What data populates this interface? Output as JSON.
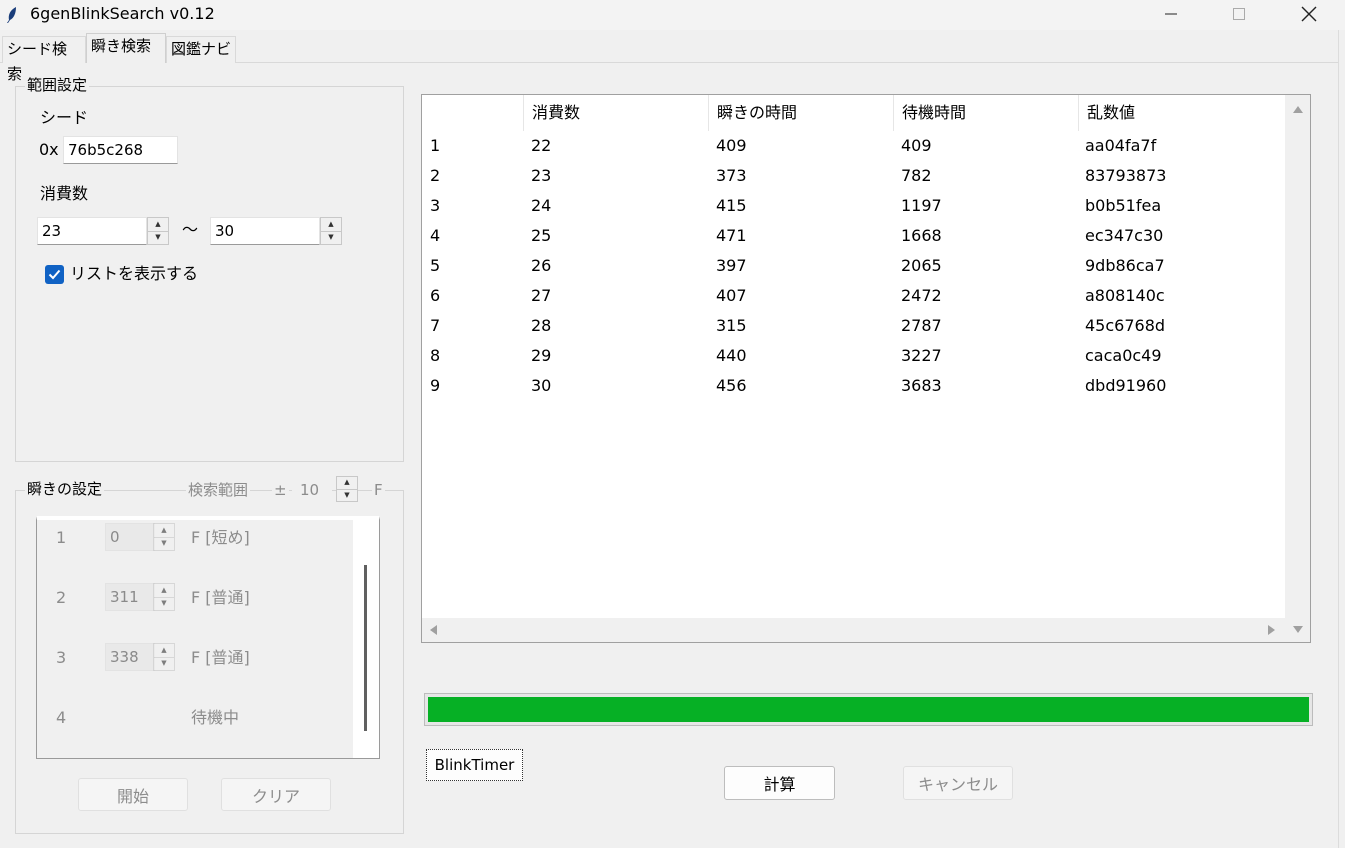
{
  "window": {
    "title": "6genBlinkSearch v0.12"
  },
  "tabs": [
    {
      "label": "シード検索"
    },
    {
      "label": "瞬き検索"
    },
    {
      "label": "図鑑ナビ"
    }
  ],
  "range_settings": {
    "group_title": "範囲設定",
    "seed_label": "シード",
    "seed_prefix": "0x",
    "seed_value": "76b5c268",
    "consumption_label": "消費数",
    "consumption_min": "23",
    "range_separator": "～",
    "consumption_max": "30",
    "show_list_label": "リストを表示する",
    "show_list_checked": true
  },
  "blink_settings": {
    "group_title": "瞬きの設定",
    "search_range_label": "検索範囲",
    "plus_minus": "±",
    "search_range_value": "10",
    "search_range_unit": "F",
    "rows": [
      {
        "index": "1",
        "value": "0",
        "type": "F [短め]"
      },
      {
        "index": "2",
        "value": "311",
        "type": "F [普通]"
      },
      {
        "index": "3",
        "value": "338",
        "type": "F [普通]"
      },
      {
        "index": "4",
        "value": "",
        "type": "待機中"
      }
    ],
    "start_button": "開始",
    "clear_button": "クリア"
  },
  "results": {
    "columns": [
      "",
      "消費数",
      "瞬きの時間",
      "待機時間",
      "乱数値"
    ],
    "rows": [
      [
        "1",
        "22",
        "409",
        "409",
        "aa04fa7f"
      ],
      [
        "2",
        "23",
        "373",
        "782",
        "83793873"
      ],
      [
        "3",
        "24",
        "415",
        "1197",
        "b0b51fea"
      ],
      [
        "4",
        "25",
        "471",
        "1668",
        "ec347c30"
      ],
      [
        "5",
        "26",
        "397",
        "2065",
        "9db86ca7"
      ],
      [
        "6",
        "27",
        "407",
        "2472",
        "a808140c"
      ],
      [
        "7",
        "28",
        "315",
        "2787",
        "45c6768d"
      ],
      [
        "8",
        "29",
        "440",
        "3227",
        "caca0c49"
      ],
      [
        "9",
        "30",
        "456",
        "3683",
        "dbd91960"
      ]
    ]
  },
  "progress": {
    "fraction": 1.0,
    "color": "#06b025"
  },
  "footer": {
    "blink_timer_button": "BlinkTimer",
    "calculate_button": "計算",
    "cancel_button": "キャンセル"
  },
  "icons": {
    "app": "feather-icon",
    "minimize": "minimize-icon",
    "maximize": "maximize-icon",
    "close": "close-icon"
  }
}
